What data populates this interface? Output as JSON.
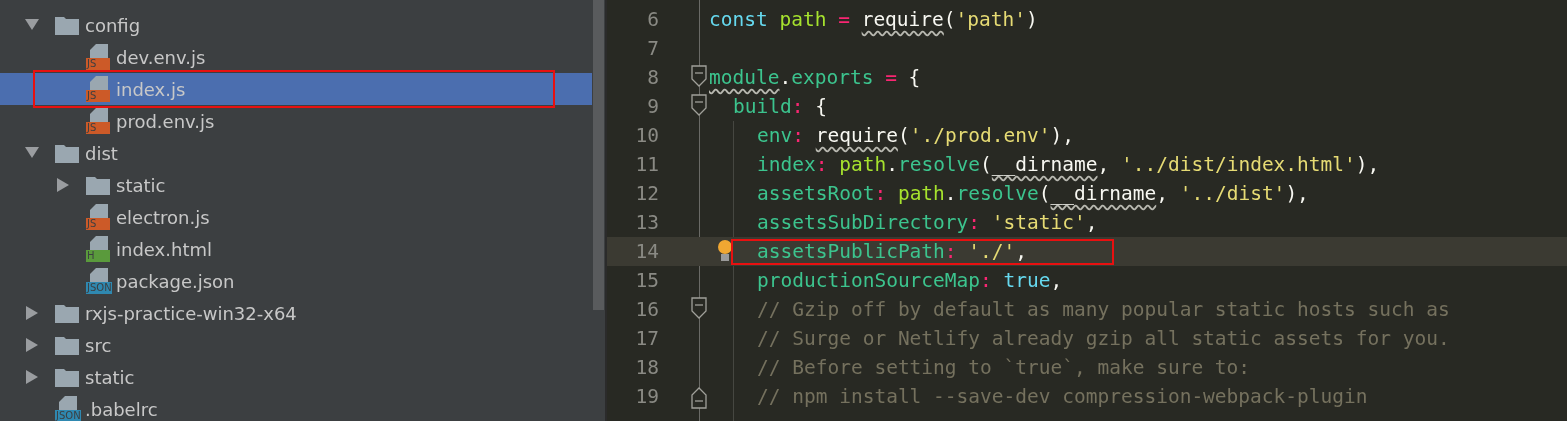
{
  "project_tree": {
    "items": [
      {
        "kind": "folder",
        "name": "config",
        "expanded": true,
        "selected": false,
        "annotated": false,
        "children": [
          {
            "kind": "file",
            "name": "dev.env.js",
            "badge": "JS",
            "color": "#cc5a28",
            "selected": false,
            "annotated": false
          },
          {
            "kind": "file",
            "name": "index.js",
            "badge": "JS",
            "color": "#cc5a28",
            "selected": true,
            "annotated": true
          },
          {
            "kind": "file",
            "name": "prod.env.js",
            "badge": "JS",
            "color": "#cc5a28",
            "selected": false,
            "annotated": false
          }
        ]
      },
      {
        "kind": "folder",
        "name": "dist",
        "expanded": true,
        "selected": false,
        "annotated": false,
        "children": [
          {
            "kind": "folder",
            "name": "static",
            "expanded": false,
            "selected": false,
            "annotated": false
          },
          {
            "kind": "file",
            "name": "electron.js",
            "badge": "JS",
            "color": "#cc5a28",
            "selected": false,
            "annotated": false
          },
          {
            "kind": "file",
            "name": "index.html",
            "badge": "H",
            "color": "#5a9a3c",
            "selected": false,
            "annotated": false
          },
          {
            "kind": "file",
            "name": "package.json",
            "badge": "JSON",
            "color": "#2f88b0",
            "selected": false,
            "annotated": false
          }
        ]
      },
      {
        "kind": "folder",
        "name": "rxjs-practice-win32-x64",
        "expanded": false,
        "selected": false,
        "annotated": false
      },
      {
        "kind": "folder",
        "name": "src",
        "expanded": false,
        "selected": false,
        "annotated": false
      },
      {
        "kind": "folder",
        "name": "static",
        "expanded": false,
        "selected": false,
        "annotated": false
      },
      {
        "kind": "file",
        "name": ".babelrc",
        "badge": "JSON",
        "color": "#2f88b0",
        "selected": false,
        "annotated": false
      }
    ]
  },
  "editor": {
    "lines": [
      {
        "number": "6",
        "current": false,
        "annotated": false,
        "bulb": false,
        "fold_start": false,
        "fold_end": false,
        "tokens": [
          {
            "kind": "keyword",
            "text": "const "
          },
          {
            "kind": "variable",
            "text": "path "
          },
          {
            "kind": "operator",
            "text": "= "
          },
          {
            "kind": "plain",
            "text": "require",
            "squiggle": true
          },
          {
            "kind": "plain",
            "text": "("
          },
          {
            "kind": "string",
            "text": "'path'"
          },
          {
            "kind": "plain",
            "text": ")"
          }
        ]
      },
      {
        "number": "7",
        "current": false,
        "annotated": false,
        "bulb": false,
        "fold_start": false,
        "fold_end": false
      },
      {
        "number": "8",
        "current": false,
        "annotated": false,
        "bulb": false,
        "fold_start": true,
        "fold_end": false,
        "tokens": [
          {
            "kind": "property",
            "text": "module",
            "squiggle": true
          },
          {
            "kind": "plain",
            "text": "."
          },
          {
            "kind": "property",
            "text": "exports "
          },
          {
            "kind": "operator",
            "text": "= "
          },
          {
            "kind": "plain",
            "text": "{"
          }
        ],
        "children": [
          {
            "number": "9",
            "current": false,
            "annotated": false,
            "bulb": false,
            "fold_start": true,
            "fold_end": false,
            "tokens": [
              {
                "kind": "property",
                "text": "build"
              },
              {
                "kind": "operator",
                "text": ": "
              },
              {
                "kind": "plain",
                "text": "{"
              }
            ],
            "children": [
              {
                "number": "10",
                "current": false,
                "annotated": false,
                "bulb": false,
                "fold_start": false,
                "fold_end": false,
                "tokens": [
                  {
                    "kind": "property",
                    "text": "env"
                  },
                  {
                    "kind": "operator",
                    "text": ": "
                  },
                  {
                    "kind": "plain",
                    "text": "require",
                    "squiggle": true
                  },
                  {
                    "kind": "plain",
                    "text": "("
                  },
                  {
                    "kind": "string",
                    "text": "'./prod.env'"
                  },
                  {
                    "kind": "plain",
                    "text": "),"
                  }
                ]
              },
              {
                "number": "11",
                "current": false,
                "annotated": false,
                "bulb": false,
                "fold_start": false,
                "fold_end": false,
                "tokens": [
                  {
                    "kind": "property",
                    "text": "index"
                  },
                  {
                    "kind": "operator",
                    "text": ": "
                  },
                  {
                    "kind": "variable",
                    "text": "path"
                  },
                  {
                    "kind": "plain",
                    "text": "."
                  },
                  {
                    "kind": "property",
                    "text": "resolve"
                  },
                  {
                    "kind": "plain",
                    "text": "("
                  },
                  {
                    "kind": "plain",
                    "text": "__dirname",
                    "squiggle": true
                  },
                  {
                    "kind": "plain",
                    "text": ", "
                  },
                  {
                    "kind": "string",
                    "text": "'../dist/index.html'"
                  },
                  {
                    "kind": "plain",
                    "text": "),"
                  }
                ]
              },
              {
                "number": "12",
                "current": false,
                "annotated": false,
                "bulb": false,
                "fold_start": false,
                "fold_end": false,
                "tokens": [
                  {
                    "kind": "property",
                    "text": "assetsRoot"
                  },
                  {
                    "kind": "operator",
                    "text": ": "
                  },
                  {
                    "kind": "variable",
                    "text": "path"
                  },
                  {
                    "kind": "plain",
                    "text": "."
                  },
                  {
                    "kind": "property",
                    "text": "resolve"
                  },
                  {
                    "kind": "plain",
                    "text": "("
                  },
                  {
                    "kind": "plain",
                    "text": "__dirname",
                    "squiggle": true
                  },
                  {
                    "kind": "plain",
                    "text": ", "
                  },
                  {
                    "kind": "string",
                    "text": "'../dist'"
                  },
                  {
                    "kind": "plain",
                    "text": "),"
                  }
                ]
              },
              {
                "number": "13",
                "current": false,
                "annotated": false,
                "bulb": false,
                "fold_start": false,
                "fold_end": false,
                "tokens": [
                  {
                    "kind": "property",
                    "text": "assetsSubDirectory"
                  },
                  {
                    "kind": "operator",
                    "text": ": "
                  },
                  {
                    "kind": "string",
                    "text": "'static'"
                  },
                  {
                    "kind": "plain",
                    "text": ","
                  }
                ]
              },
              {
                "number": "14",
                "current": true,
                "annotated": true,
                "bulb": true,
                "fold_start": false,
                "fold_end": false,
                "tokens": [
                  {
                    "kind": "property",
                    "text": "assetsPublicPath"
                  },
                  {
                    "kind": "operator",
                    "text": ": "
                  },
                  {
                    "kind": "string",
                    "text": "'./'"
                  },
                  {
                    "kind": "plain",
                    "text": ","
                  }
                ]
              },
              {
                "number": "15",
                "current": false,
                "annotated": false,
                "bulb": false,
                "fold_start": false,
                "fold_end": false,
                "tokens": [
                  {
                    "kind": "property",
                    "text": "productionSourceMap"
                  },
                  {
                    "kind": "operator",
                    "text": ": "
                  },
                  {
                    "kind": "keyword",
                    "text": "true"
                  },
                  {
                    "kind": "plain",
                    "text": ","
                  }
                ]
              },
              {
                "number": "16",
                "current": false,
                "annotated": false,
                "bulb": false,
                "fold_start": true,
                "fold_end": false,
                "tokens": [
                  {
                    "kind": "comment",
                    "text": "// Gzip off by default as many popular static hosts such as"
                  }
                ]
              },
              {
                "number": "17",
                "current": false,
                "annotated": false,
                "bulb": false,
                "fold_start": false,
                "fold_end": false,
                "tokens": [
                  {
                    "kind": "comment",
                    "text": "// Surge or Netlify already gzip all static assets for you."
                  }
                ]
              },
              {
                "number": "18",
                "current": false,
                "annotated": false,
                "bulb": false,
                "fold_start": false,
                "fold_end": false,
                "tokens": [
                  {
                    "kind": "comment",
                    "text": "// Before setting to `true`, make sure to:"
                  }
                ]
              },
              {
                "number": "19",
                "current": false,
                "annotated": false,
                "bulb": false,
                "fold_start": false,
                "fold_end": true,
                "tokens": [
                  {
                    "kind": "comment",
                    "text": "// npm install --save-dev compression-webpack-plugin"
                  }
                ]
              }
            ]
          }
        ]
      }
    ]
  }
}
